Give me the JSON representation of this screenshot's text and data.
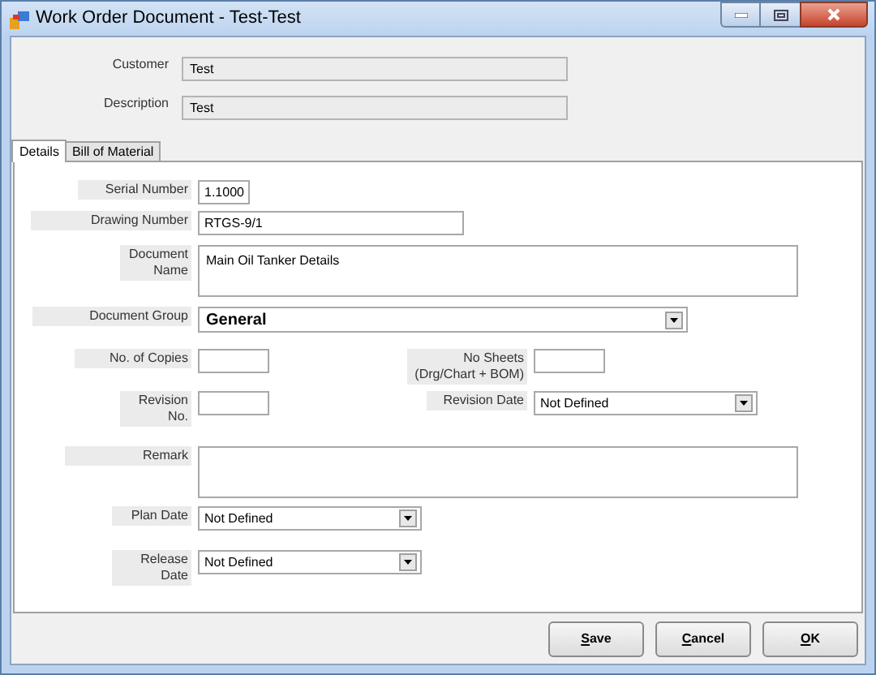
{
  "window": {
    "title": "Work Order Document - Test-Test"
  },
  "header": [
    {
      "label": "Customer",
      "value": "Test"
    },
    {
      "label": "Description",
      "value": "Test"
    }
  ],
  "tabs": [
    {
      "label": "Details",
      "selected": true
    },
    {
      "label": "Bill of Material",
      "selected": false
    }
  ],
  "rows": [
    {
      "fields": [
        {
          "label": "Serial Number",
          "kind": "short",
          "value": "1.1000"
        }
      ]
    },
    {
      "fields": [
        {
          "label": "Drawing Number",
          "kind": "text",
          "value": "RTGS-9/1"
        }
      ]
    },
    {
      "fields": [
        {
          "label": "Document Name",
          "kind": "memo",
          "value": "Main Oil Tanker Details"
        }
      ]
    },
    {
      "fields": [
        {
          "label": "Document Group",
          "kind": "group",
          "value": "General"
        }
      ]
    },
    {
      "fields": [
        {
          "label": "No. of Copies",
          "kind": "small"
        },
        {
          "label": "No Sheets (Drg/Chart + BOM)",
          "kind": "small"
        }
      ]
    },
    {
      "fields": [
        {
          "label": "Revision No.",
          "kind": "small"
        },
        {
          "label": "Revision Date",
          "kind": "date",
          "value": "Not Defined"
        }
      ]
    },
    {
      "fields": [
        {
          "label": "Remark",
          "kind": "memo"
        }
      ]
    },
    {
      "fields": [
        {
          "label": "Plan Date",
          "kind": "date",
          "value": "Not Defined"
        }
      ]
    },
    {
      "fields": [
        {
          "label": "Release Date",
          "kind": "date",
          "value": "Not Defined"
        }
      ]
    }
  ],
  "buttons": [
    {
      "label": "Save"
    },
    {
      "label": "Cancel"
    },
    {
      "label": "OK"
    }
  ]
}
